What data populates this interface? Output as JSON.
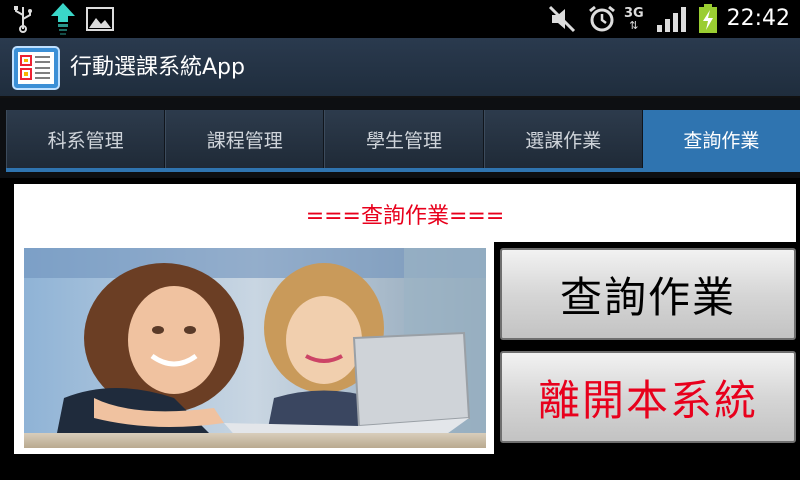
{
  "status_bar": {
    "time": "22:42",
    "network_label": "3G",
    "icons": [
      "usb-icon",
      "upload-icon",
      "image-icon",
      "mute-icon",
      "alarm-icon",
      "network-3g-icon",
      "signal-icon",
      "battery-charging-icon"
    ]
  },
  "action_bar": {
    "title": "行動選課系統App"
  },
  "tabs": [
    {
      "label": "科系管理",
      "active": false
    },
    {
      "label": "課程管理",
      "active": false
    },
    {
      "label": "學生管理",
      "active": false
    },
    {
      "label": "選課作業",
      "active": false
    },
    {
      "label": "查詢作業",
      "active": true
    }
  ],
  "main": {
    "heading": "===查詢作業===",
    "query_button": "查詢作業",
    "exit_button": "離開本系統"
  },
  "colors": {
    "accent": "#2f74b0",
    "heading_red": "#e8001c",
    "action_bar": "#25354a"
  }
}
